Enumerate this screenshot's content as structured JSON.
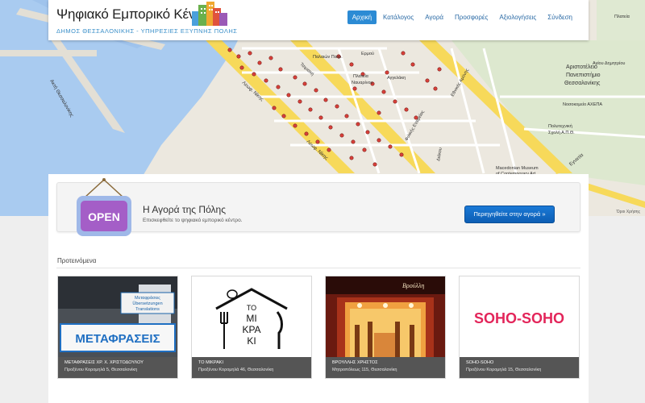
{
  "header": {
    "title": "Ψηφιακό Εμπορικό Κέντρο",
    "subtitle": "ΔΗΜΟΣ ΘΕΣΣΑΛΟΝΙΚΗΣ - ΥΠΗΡΕΣΙΕΣ ΕΞΥΠΝΗΣ ΠΟΛΗΣ",
    "logo_icon": "city-buildings-icon"
  },
  "nav": {
    "items": [
      {
        "label": "Αρχική",
        "active": true
      },
      {
        "label": "Κατάλογος",
        "active": false
      },
      {
        "label": "Αγορά",
        "active": false
      },
      {
        "label": "Προσφορές",
        "active": false
      },
      {
        "label": "Αξιολογήσεις",
        "active": false
      },
      {
        "label": "Σύνδεση",
        "active": false
      }
    ],
    "accent": "#2c8bd4"
  },
  "map": {
    "labels": {
      "leoforos_nikis": "Λεωφ. Νίκης",
      "aristotle": "Αριστοτέλειο",
      "panepistimio": "Πανεπιστήμιο",
      "thessalonikis": "Θεσσαλονίκης",
      "hospital": "Νοσοκομείο ΑΧΕΠΑ",
      "polytechnic_1": "Πολυτεχνική",
      "polytechnic_2": "Σχολή Α.Π.Θ.",
      "museum_1": "Macedonian Museum",
      "museum_2": "of Contemporary Art",
      "egnatia": "Εγνατία",
      "tsimiski": "Τσιμισκή",
      "ermou": "Ερμού",
      "palaion_patron": "Παλαιών Πατρ.",
      "plateia_navarinou": "Πλατεία",
      "plateia_navarinou_2": "Ναυαρίνου",
      "ethnikis_aminis": "Εθνικής Αμύνης",
      "diakritou": "Διάκου",
      "akti_thessalonikis": "Ακτή Θεσσαλονίκης",
      "angelaki": "Αγγελάκη",
      "dimitriou": "Αγίου Δημητρίου",
      "filikis_eterias": "Φιλικής Εταιρείας",
      "ag_sofias": "Αγ. Σοφίας",
      "plateia": "Πλατεία"
    },
    "attribution": "Όροι Χρήσης"
  },
  "hero": {
    "sign_text": "OPEN",
    "title": "Η Αγορά της Πόλης",
    "description": "Επισκεφθείτε το ψηφιακό εμπορικό κέντρο.",
    "button_label": "Περιηγηθείτε στην αγορά »"
  },
  "featured": {
    "label": "Προτεινόμενα",
    "cards": [
      {
        "name": "ΜΕΤΑΦΡΑΣΕΙΣ ΧΡ. Χ. ΧΡΙΣΤΟΔΟΥΛΟΥ",
        "address": "Προξένου Κορομηλά 5, Θεσσαλονίκη",
        "sign_text": "ΜΕΤΑΦΡΑΣΕΙΣ",
        "sign_small_1": "Μεταφράσεις",
        "sign_small_2": "Übersetzungen",
        "sign_small_3": "Translations"
      },
      {
        "name": "ΤΟ ΜΙΚΡΑΚΙ",
        "address": "Προξένου Κορομηλά 46, Θεσσαλονίκη",
        "logo_line_1": "ΤΟ",
        "logo_line_2": "ΜΙ",
        "logo_line_3": "ΚΡΑ",
        "logo_line_4": "ΚΙ"
      },
      {
        "name": "ΒΡΟΥΛΛΗΣ ΧΡΗΣΤΟΣ",
        "address": "Μητροπόλεως 115, Θεσσαλονίκη",
        "sign_text": "Βρούλλη"
      },
      {
        "name": "SOHO-SOHO",
        "address": "Προξένου Κορομηλά 15, Θεσσαλονίκη",
        "logo_text": "SOHO-SOHO"
      }
    ]
  }
}
